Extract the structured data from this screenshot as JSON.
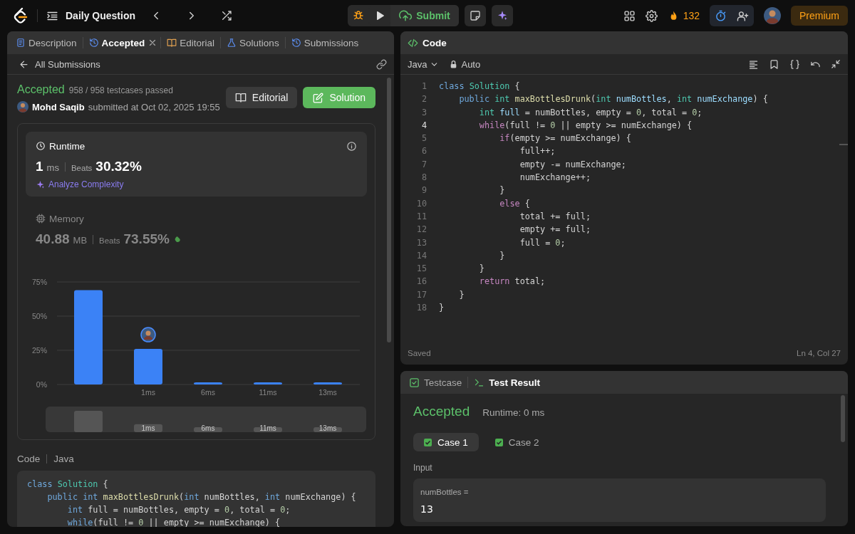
{
  "topbar": {
    "title": "Daily Question",
    "submit": "Submit",
    "streak": "132",
    "premium": "Premium"
  },
  "left_panel": {
    "tabs": [
      {
        "label": "Description",
        "selected": false,
        "closable": false
      },
      {
        "label": "Accepted",
        "selected": true,
        "closable": true
      },
      {
        "label": "Editorial",
        "selected": false,
        "closable": false
      },
      {
        "label": "Solutions",
        "selected": false,
        "closable": false
      },
      {
        "label": "Submissions",
        "selected": false,
        "closable": false
      }
    ],
    "back_link": "All Submissions",
    "submission": {
      "status": "Accepted",
      "testcases": "958 / 958 testcases passed",
      "user": "Mohd Saqib",
      "submitted": "submitted at Oct 02, 2025 19:55"
    },
    "buttons": [
      "Editorial",
      "Solution"
    ],
    "metrics": [
      {
        "title": "Runtime",
        "value": "1",
        "unit": "ms",
        "beats_label": "Beats",
        "beats": "30.32%",
        "selected": true,
        "link": "Analyze Complexity"
      },
      {
        "title": "Memory",
        "value": "40.88",
        "unit": "MB",
        "beats_label": "Beats",
        "beats": "73.55%",
        "selected": false
      }
    ],
    "distribution": {
      "chart_data": {
        "type": "bar",
        "categories": [
          null,
          "1ms",
          "6ms",
          "11ms",
          "13ms"
        ],
        "values": [
          69,
          26,
          1.5,
          1.5,
          1.5
        ],
        "ylim": [
          0,
          75
        ],
        "yticks": [
          {
            "value": 0,
            "label": "0%"
          },
          {
            "value": 25,
            "label": "25%"
          },
          {
            "value": 50,
            "label": "50%"
          },
          {
            "value": 75,
            "label": "75%"
          }
        ],
        "annotations": [
          {
            "x": "1ms"
          }
        ]
      }
    },
    "overview": {
      "labels": [
        "1ms",
        "6ms",
        "11ms",
        "13ms"
      ]
    },
    "code_label": "Code",
    "code_language": "Java",
    "code_lines": [
      {
        "tokens": [
          {
            "kind": "kw",
            "text": "class "
          },
          {
            "kind": "ty",
            "text": "Solution"
          },
          {
            "kind": "p",
            "text": " {"
          }
        ]
      },
      {
        "tokens": [
          {
            "kind": "kw",
            "text": "    public int "
          },
          {
            "kind": "fn",
            "text": "maxBottlesDrunk"
          },
          {
            "kind": "p",
            "text": "("
          },
          {
            "kind": "kw",
            "text": "int"
          },
          {
            "kind": "p",
            "text": " numBottles, "
          },
          {
            "kind": "kw",
            "text": "int"
          },
          {
            "kind": "p",
            "text": " numExchange) {"
          }
        ]
      },
      {
        "tokens": [
          {
            "kind": "kw",
            "text": "        int"
          },
          {
            "kind": "p",
            "text": " full = numBottles, empty = "
          },
          {
            "kind": "num",
            "text": "0"
          },
          {
            "kind": "p",
            "text": ", total = "
          },
          {
            "kind": "num",
            "text": "0"
          },
          {
            "kind": "p",
            "text": ";"
          }
        ]
      },
      {
        "tokens": [
          {
            "kind": "kw",
            "text": "        while"
          },
          {
            "kind": "p",
            "text": "(full != "
          },
          {
            "kind": "num",
            "text": "0"
          },
          {
            "kind": "p",
            "text": " || empty >= numExchange) {"
          }
        ]
      }
    ]
  },
  "code_panel": {
    "title": "Code",
    "language": "Java",
    "mode": "Auto",
    "status": "Saved",
    "cursor": "Ln 4, Col 27",
    "lines": [
      {
        "number": "1",
        "current": false,
        "tokens": [
          {
            "kind": "kw",
            "text": "class "
          },
          {
            "kind": "ty",
            "text": "Solution"
          },
          {
            "kind": "p",
            "text": " {"
          }
        ]
      },
      {
        "number": "2",
        "current": false,
        "tokens": [
          {
            "kind": "kw",
            "text": "    public "
          },
          {
            "kind": "ty",
            "text": "int "
          },
          {
            "kind": "fn",
            "text": "maxBottlesDrunk"
          },
          {
            "kind": "p",
            "text": "("
          },
          {
            "kind": "ty",
            "text": "int "
          },
          {
            "kind": "var",
            "text": "numBottles"
          },
          {
            "kind": "p",
            "text": ", "
          },
          {
            "kind": "ty",
            "text": "int "
          },
          {
            "kind": "var",
            "text": "numExchange"
          },
          {
            "kind": "p",
            "text": ") {"
          }
        ]
      },
      {
        "number": "3",
        "current": false,
        "tokens": [
          {
            "kind": "ty",
            "text": "        int "
          },
          {
            "kind": "var",
            "text": "full"
          },
          {
            "kind": "p",
            "text": " = numBottles, empty = "
          },
          {
            "kind": "num",
            "text": "0"
          },
          {
            "kind": "p",
            "text": ", total = "
          },
          {
            "kind": "num",
            "text": "0"
          },
          {
            "kind": "p",
            "text": ";"
          }
        ]
      },
      {
        "number": "4",
        "current": true,
        "tokens": [
          {
            "kind": "ctl",
            "text": "        while"
          },
          {
            "kind": "p",
            "text": "(full != "
          },
          {
            "kind": "num",
            "text": "0"
          },
          {
            "kind": "p",
            "text": " || empty >= numExchange) {"
          }
        ]
      },
      {
        "number": "5",
        "current": false,
        "tokens": [
          {
            "kind": "ctl",
            "text": "            if"
          },
          {
            "kind": "p",
            "text": "(empty >= numExchange) {"
          }
        ]
      },
      {
        "number": "6",
        "current": false,
        "tokens": [
          {
            "kind": "p",
            "text": "                full++;"
          }
        ]
      },
      {
        "number": "7",
        "current": false,
        "tokens": [
          {
            "kind": "p",
            "text": "                empty -= numExchange;"
          }
        ]
      },
      {
        "number": "8",
        "current": false,
        "tokens": [
          {
            "kind": "p",
            "text": "                numExchange++;"
          }
        ]
      },
      {
        "number": "9",
        "current": false,
        "tokens": [
          {
            "kind": "p",
            "text": "            }"
          }
        ]
      },
      {
        "number": "10",
        "current": false,
        "tokens": [
          {
            "kind": "ctl",
            "text": "            else"
          },
          {
            "kind": "p",
            "text": " {"
          }
        ]
      },
      {
        "number": "11",
        "current": false,
        "tokens": [
          {
            "kind": "p",
            "text": "                total += full;"
          }
        ]
      },
      {
        "number": "12",
        "current": false,
        "tokens": [
          {
            "kind": "p",
            "text": "                empty += full;"
          }
        ]
      },
      {
        "number": "13",
        "current": false,
        "tokens": [
          {
            "kind": "p",
            "text": "                full = "
          },
          {
            "kind": "num",
            "text": "0"
          },
          {
            "kind": "p",
            "text": ";"
          }
        ]
      },
      {
        "number": "14",
        "current": false,
        "tokens": [
          {
            "kind": "p",
            "text": "            }"
          }
        ]
      },
      {
        "number": "15",
        "current": false,
        "tokens": [
          {
            "kind": "p",
            "text": "        }"
          }
        ]
      },
      {
        "number": "16",
        "current": false,
        "tokens": [
          {
            "kind": "ctl",
            "text": "        return"
          },
          {
            "kind": "p",
            "text": " total;"
          }
        ]
      },
      {
        "number": "17",
        "current": false,
        "tokens": [
          {
            "kind": "p",
            "text": "    }"
          }
        ]
      },
      {
        "number": "18",
        "current": false,
        "tokens": [
          {
            "kind": "p",
            "text": "}"
          }
        ]
      }
    ]
  },
  "result_panel": {
    "tabs": [
      {
        "label": "Testcase",
        "selected": false
      },
      {
        "label": "Test Result",
        "selected": true
      }
    ],
    "status": "Accepted",
    "runtime": "Runtime: 0 ms",
    "cases": [
      {
        "label": "Case 1",
        "selected": true,
        "passed": true
      },
      {
        "label": "Case 2",
        "selected": false,
        "passed": true
      }
    ],
    "input_label": "Input",
    "inputs": [
      {
        "name": "numBottles =",
        "value": "13"
      }
    ]
  }
}
